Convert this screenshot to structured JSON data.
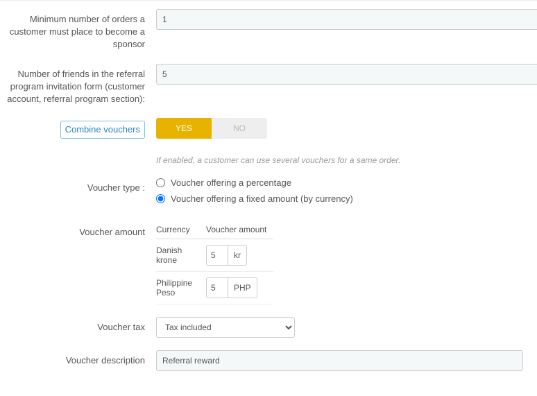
{
  "fields": {
    "min_orders": {
      "label": "Minimum number of orders a customer must place to become a sponsor",
      "value": "1"
    },
    "num_friends": {
      "label": "Number of friends in the referral program invitation form (customer account, referral program section):",
      "value": "5"
    },
    "combine": {
      "label": "Combine vouchers",
      "yes": "YES",
      "no": "NO",
      "help": "If enabled, a customer can use several vouchers for a same order."
    },
    "voucher_type": {
      "label": "Voucher type :",
      "options": {
        "percentage": "Voucher offering a percentage",
        "fixed": "Voucher offering a fixed amount (by currency)"
      },
      "selected": "fixed"
    },
    "voucher_amount": {
      "label": "Voucher amount",
      "headers": {
        "currency": "Currency",
        "amount": "Voucher amount"
      },
      "rows": [
        {
          "currency": "Danish krone",
          "value": "5",
          "symbol": "kr"
        },
        {
          "currency": "Philippine Peso",
          "value": "5",
          "symbol": "PHP"
        }
      ]
    },
    "voucher_tax": {
      "label": "Voucher tax",
      "selected": "Tax included"
    },
    "voucher_desc": {
      "label": "Voucher description",
      "value": "Referral reward"
    }
  }
}
